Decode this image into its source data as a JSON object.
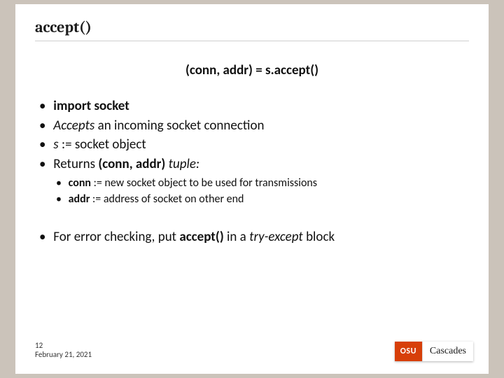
{
  "title": "accept()",
  "signature": "(conn, addr) = s.accept()",
  "bullets": {
    "b1_pre": "",
    "b1_bold": "import socket",
    "b2_italic": "Accepts",
    "b2_rest": " an incoming socket connection",
    "b3_italic": "s",
    "b3_rest": " := socket object",
    "b4_pre": "Returns ",
    "b4_bold": "(conn, addr)",
    "b4_italic_tail": " tuple:"
  },
  "sub": {
    "s1_bold": "conn",
    "s1_rest": " := new socket object to be used for transmissions",
    "s2_bold": "addr",
    "s2_rest": " := address of socket on other end"
  },
  "final": {
    "pre": "For error checking, put ",
    "bold": "accept()",
    "mid": " in a ",
    "italic": "try-except",
    "post": " block"
  },
  "footer": {
    "slide_number": "12",
    "date": "February 21, 2021"
  },
  "logo": {
    "badge": "OSU",
    "text": "Cascades"
  }
}
